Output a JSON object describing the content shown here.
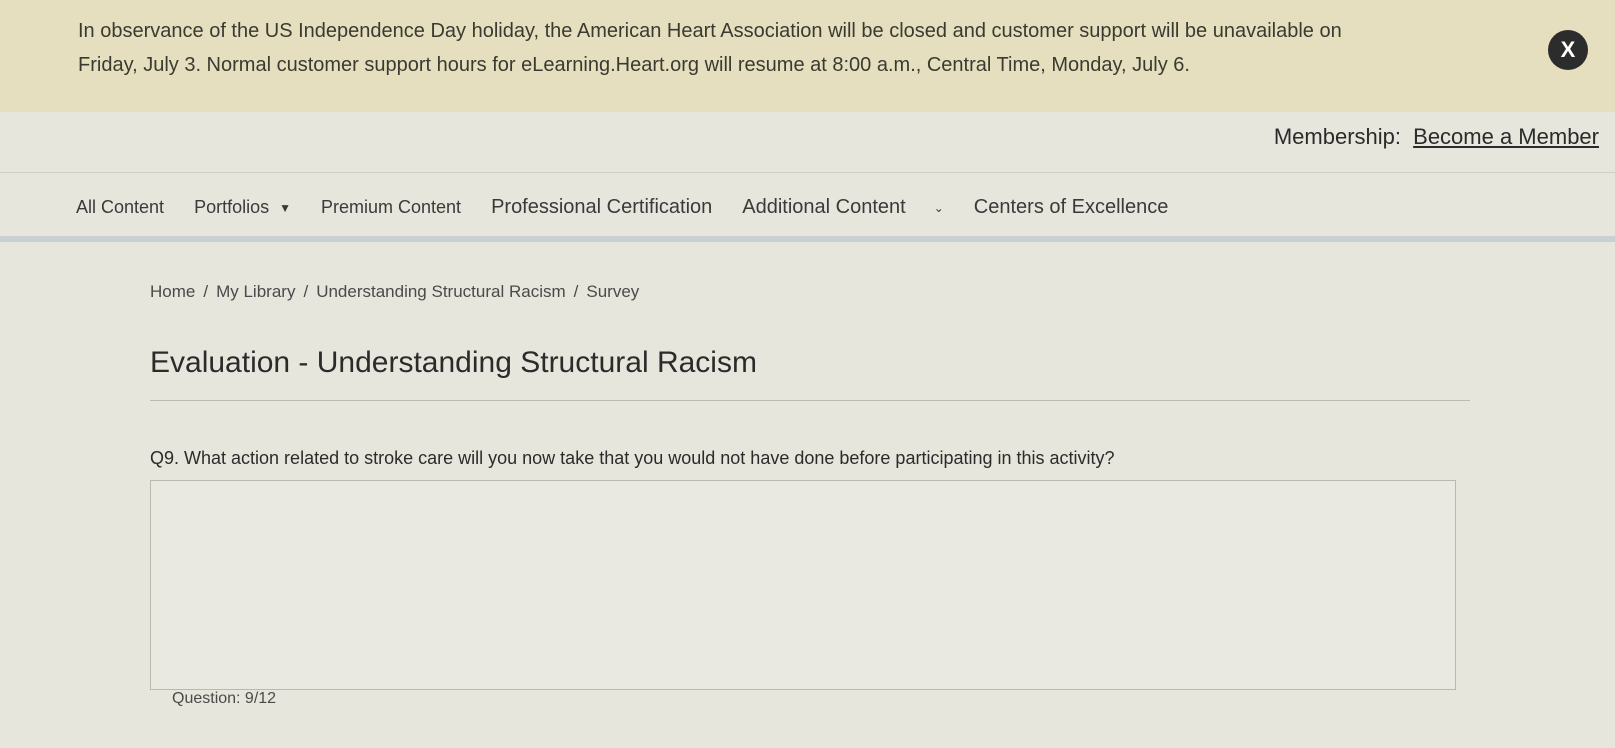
{
  "banner": {
    "line1": "In observance of the US Independence Day holiday, the American Heart Association will be closed and customer support will be unavailable on",
    "line2": "Friday, July 3. Normal customer support hours for eLearning.Heart.org will resume at 8:00 a.m., Central Time, Monday, July 6.",
    "close_label": "X"
  },
  "membership": {
    "label": "Membership:",
    "link": "Become a Member"
  },
  "nav": {
    "items": [
      {
        "label": "All Content"
      },
      {
        "label": "Portfolios",
        "dropdown": true
      },
      {
        "label": "Premium Content"
      },
      {
        "label": "Professional Certification"
      },
      {
        "label": "Additional Content",
        "dropdown": true
      },
      {
        "label": "Centers of Excellence"
      }
    ]
  },
  "breadcrumb": [
    "Home",
    "My Library",
    "Understanding Structural Racism",
    "Survey"
  ],
  "page_title": "Evaluation - Understanding Structural Racism",
  "question": {
    "text": "Q9.  What action related to stroke care will you now take that you would not have done before participating in this activity?",
    "answer_value": "",
    "progress": "Question: 9/12"
  }
}
